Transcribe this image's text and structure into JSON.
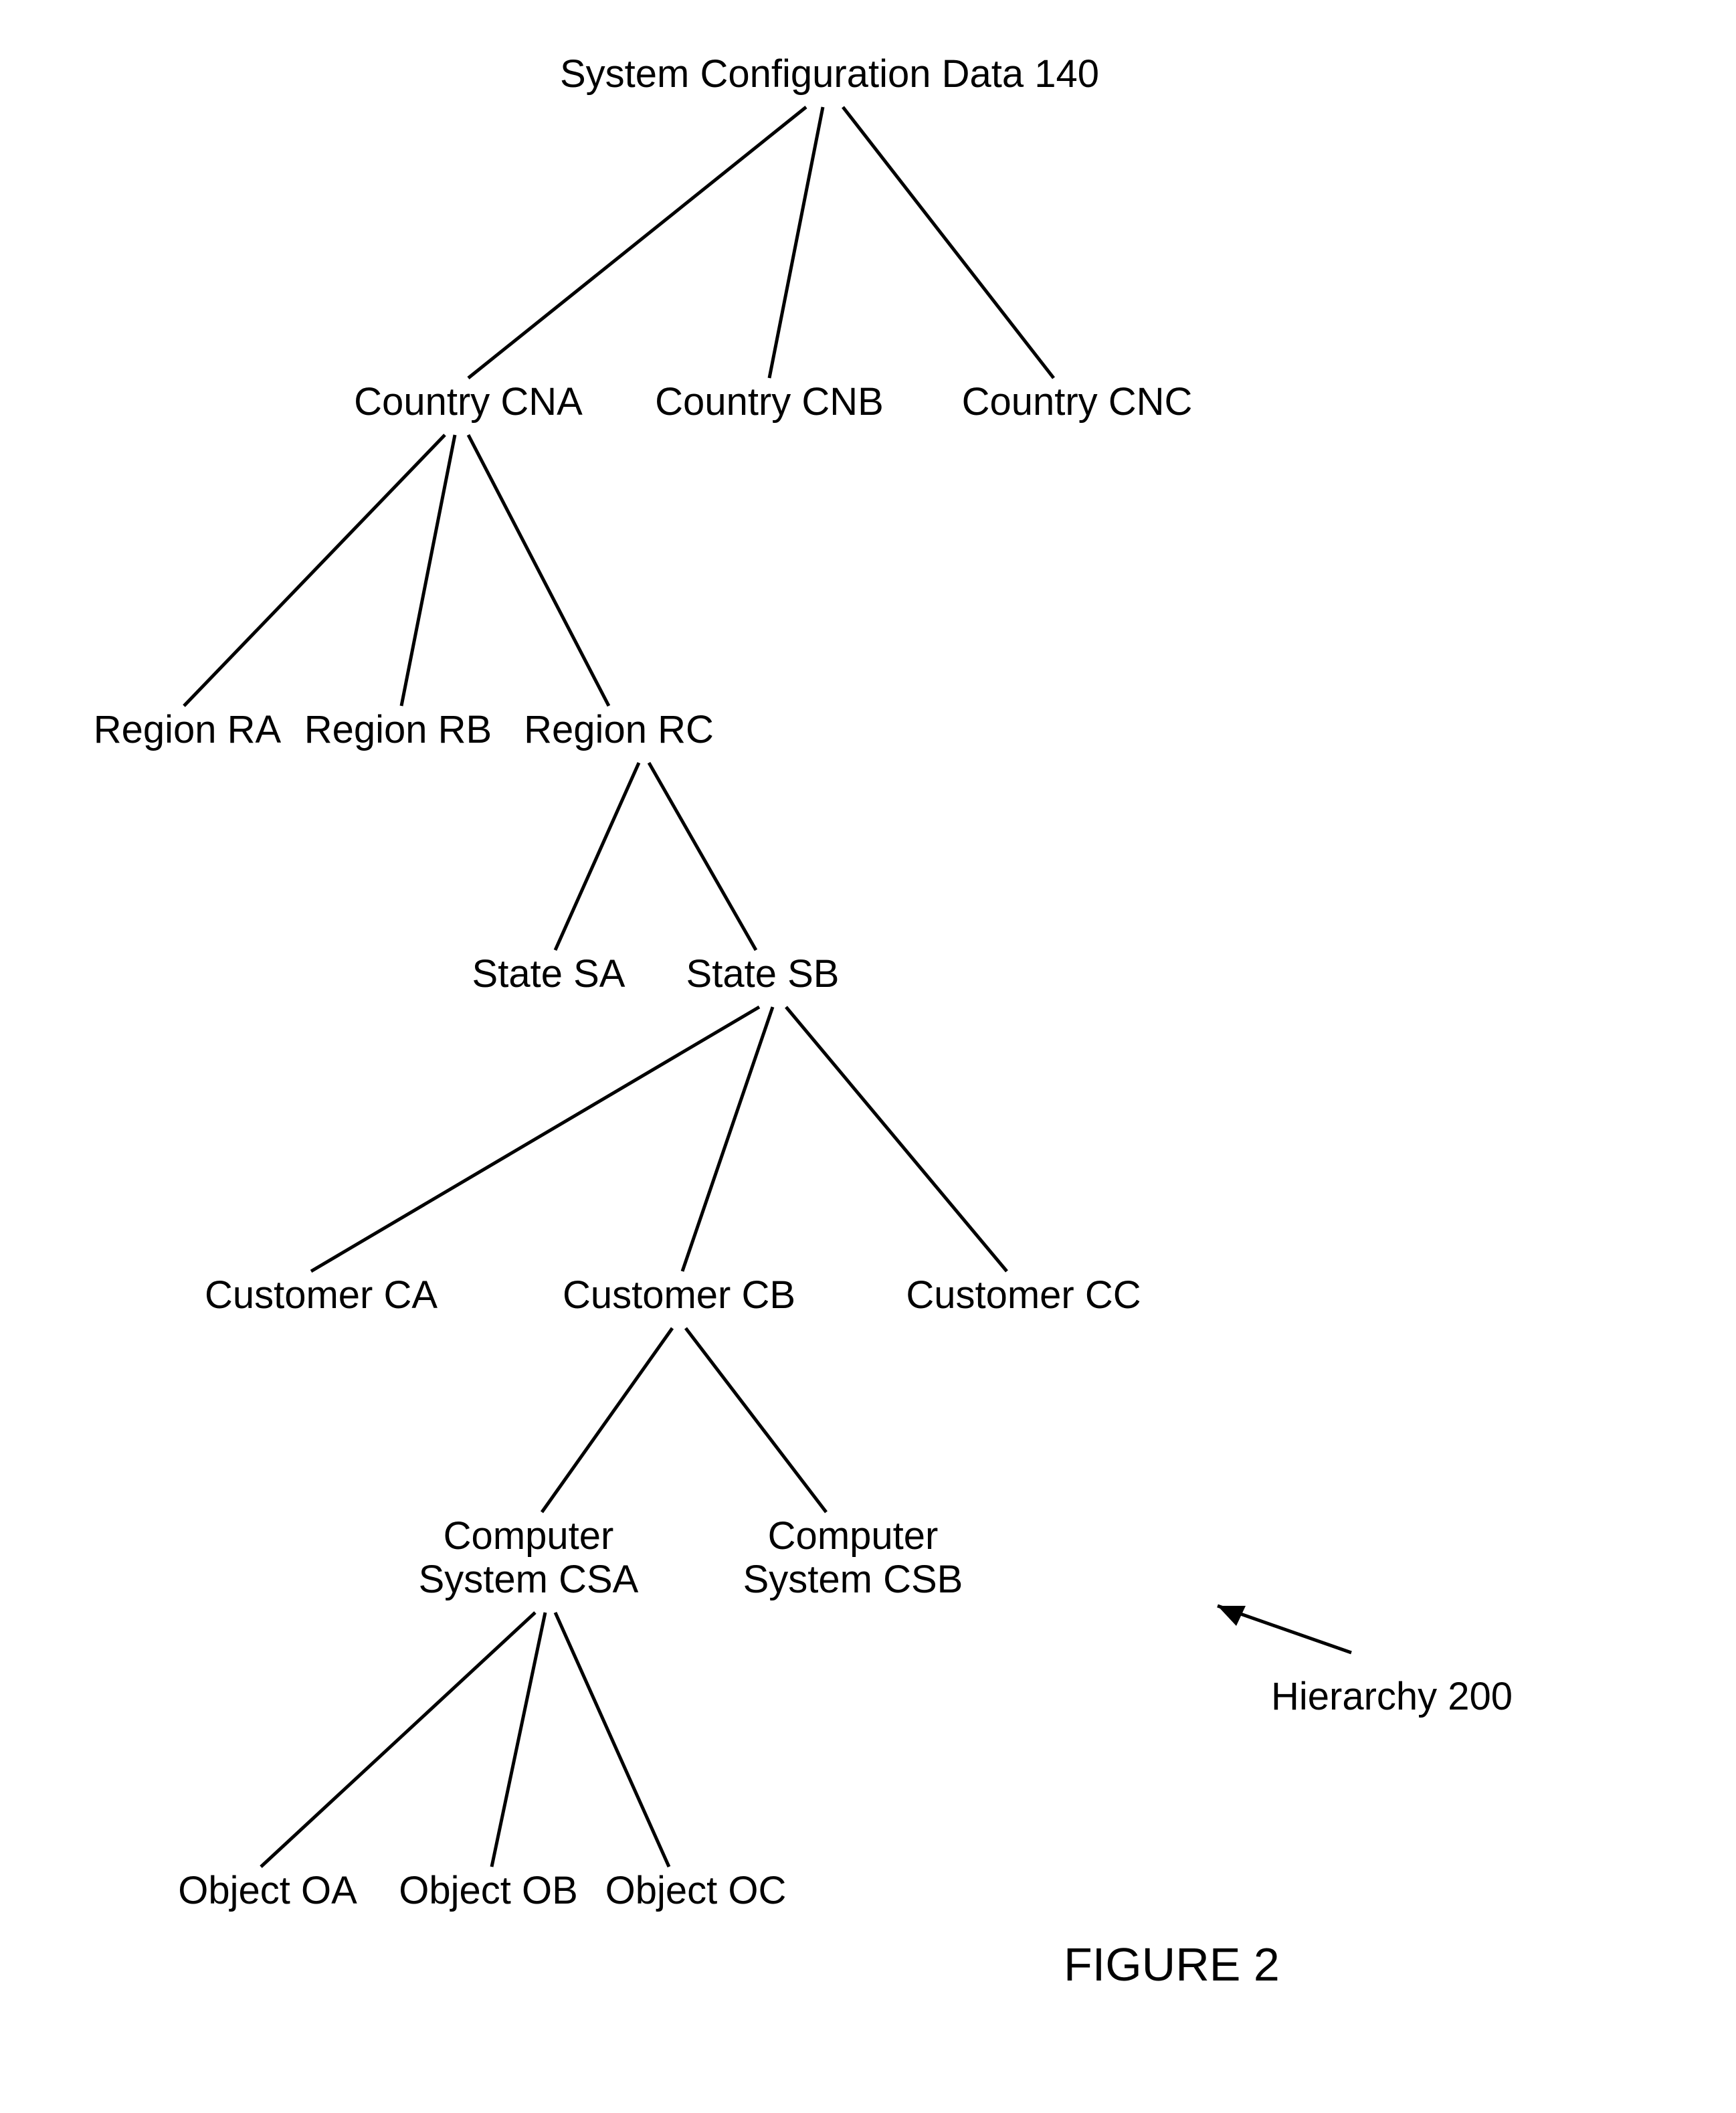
{
  "title": "System Configuration Data 140",
  "figure_caption": "FIGURE 2",
  "annotation": "Hierarchy 200",
  "nodes": {
    "root": {
      "label": "System Configuration Data 140"
    },
    "country_a": {
      "label": "Country CNA"
    },
    "country_b": {
      "label": "Country CNB"
    },
    "country_c": {
      "label": "Country CNC"
    },
    "region_a": {
      "label": "Region RA"
    },
    "region_b": {
      "label": "Region RB"
    },
    "region_c": {
      "label": "Region RC"
    },
    "state_a": {
      "label": "State SA"
    },
    "state_b": {
      "label": "State SB"
    },
    "customer_a": {
      "label": "Customer CA"
    },
    "customer_b": {
      "label": "Customer CB"
    },
    "customer_c": {
      "label": "Customer CC"
    },
    "system_a_l1": {
      "label": "Computer"
    },
    "system_a_l2": {
      "label": "System CSA"
    },
    "system_b_l1": {
      "label": "Computer"
    },
    "system_b_l2": {
      "label": "System CSB"
    },
    "object_a": {
      "label": "Object OA"
    },
    "object_b": {
      "label": "Object OB"
    },
    "object_c": {
      "label": "Object OC"
    }
  },
  "hierarchy": {
    "System Configuration Data 140": {
      "Country CNA": {
        "Region RA": {},
        "Region RB": {},
        "Region RC": {
          "State SA": {},
          "State SB": {
            "Customer CA": {},
            "Customer CB": {
              "Computer System CSA": {
                "Object OA": {},
                "Object OB": {},
                "Object OC": {}
              },
              "Computer System CSB": {}
            },
            "Customer CC": {}
          }
        }
      },
      "Country CNB": {},
      "Country CNC": {}
    }
  }
}
